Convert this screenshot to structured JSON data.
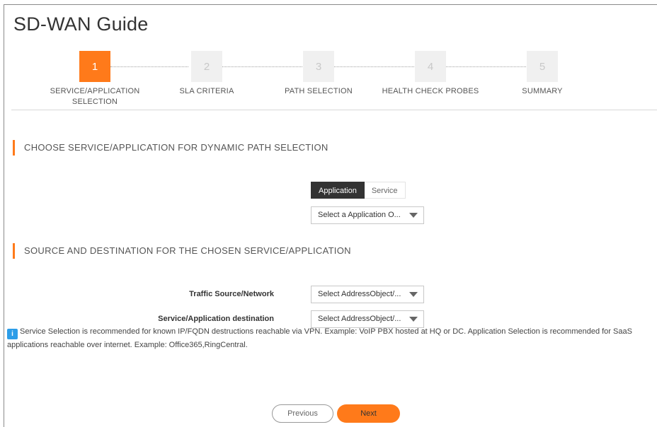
{
  "page": {
    "title": "SD-WAN Guide"
  },
  "stepper": {
    "steps": [
      {
        "number": "1",
        "label_line1": "SERVICE/APPLICATION",
        "label_line2": "SELECTION",
        "active": true
      },
      {
        "number": "2",
        "label_line1": "SLA CRITERIA",
        "label_line2": "",
        "active": false
      },
      {
        "number": "3",
        "label_line1": "PATH SELECTION",
        "label_line2": "",
        "active": false
      },
      {
        "number": "4",
        "label_line1": "HEALTH CHECK PROBES",
        "label_line2": "",
        "active": false
      },
      {
        "number": "5",
        "label_line1": "SUMMARY",
        "label_line2": "",
        "active": false
      }
    ]
  },
  "section1": {
    "title": "CHOOSE SERVICE/APPLICATION FOR DYNAMIC PATH SELECTION",
    "toggle": {
      "application_label": "Application",
      "service_label": "Service",
      "selected": "Application"
    },
    "select_value": "Select a Application O..."
  },
  "section2": {
    "title": "SOURCE AND DESTINATION FOR THE CHOSEN SERVICE/APPLICATION",
    "source_label": "Traffic Source/Network",
    "source_value": "Select AddressObject/...",
    "destination_label": "Service/Application destination",
    "destination_value": "Select AddressObject/..."
  },
  "info": {
    "icon": "info-icon",
    "text": "Service Selection is recommended for known IP/FQDN destructions reachable via VPN. Example: VoIP PBX hosted at HQ or DC. Application Selection is recommended for SaaS applications reachable over internet. Example: Office365,RingCentral."
  },
  "footer": {
    "previous_label": "Previous",
    "next_label": "Next"
  },
  "colors": {
    "accent": "#ff7a1a",
    "info_blue": "#2c9de8",
    "toggle_active": "#333333"
  }
}
